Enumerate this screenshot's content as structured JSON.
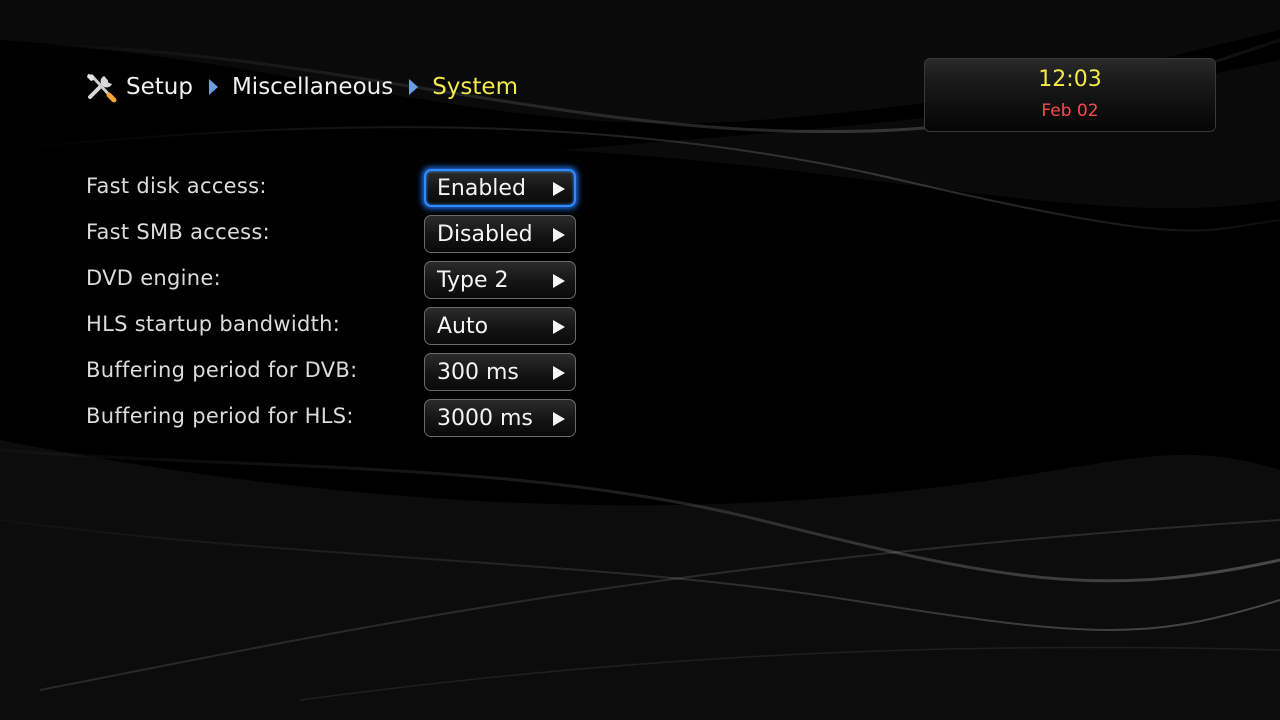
{
  "breadcrumb": {
    "items": [
      {
        "label": "Setup"
      },
      {
        "label": "Miscellaneous"
      },
      {
        "label": "System"
      }
    ],
    "icon": "tools-icon",
    "separator_icon": "chevron-right-icon"
  },
  "clock": {
    "time": "12:03",
    "date": "Feb 02"
  },
  "settings": [
    {
      "label": "Fast disk access:",
      "value": "Enabled",
      "focused": true
    },
    {
      "label": "Fast SMB access:",
      "value": "Disabled",
      "focused": false
    },
    {
      "label": "DVD engine:",
      "value": "Type 2",
      "focused": false
    },
    {
      "label": "HLS startup bandwidth:",
      "value": "Auto",
      "focused": false
    },
    {
      "label": "Buffering period for DVB:",
      "value": "300 ms",
      "focused": false
    },
    {
      "label": "Buffering period for HLS:",
      "value": "3000 ms",
      "focused": false
    }
  ],
  "colors": {
    "background": "#000000",
    "breadcrumb_current": "#f3e94a",
    "clock_time": "#f3e94a",
    "clock_date": "#ff4a4a",
    "focus_glow": "#2f8bff",
    "separator": "#6b9fe0"
  }
}
